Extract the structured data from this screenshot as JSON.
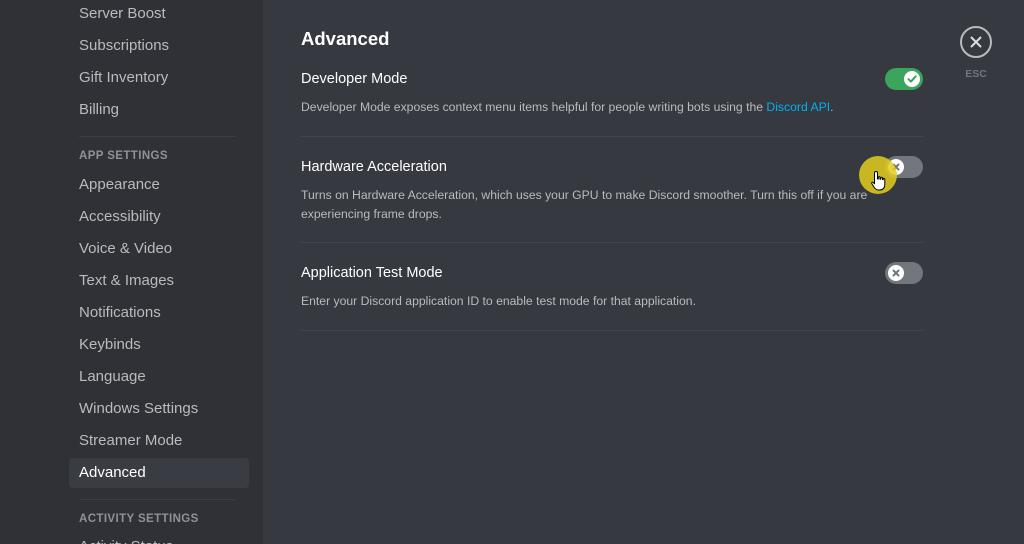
{
  "sidebar": {
    "top_items": [
      "Server Boost",
      "Subscriptions",
      "Gift Inventory",
      "Billing"
    ],
    "app_settings_header": "APP SETTINGS",
    "app_items": [
      "Appearance",
      "Accessibility",
      "Voice & Video",
      "Text & Images",
      "Notifications",
      "Keybinds",
      "Language",
      "Windows Settings",
      "Streamer Mode",
      "Advanced"
    ],
    "selected": "Advanced",
    "activity_settings_header": "ACTIVITY SETTINGS",
    "activity_items": [
      "Activity Status"
    ]
  },
  "main": {
    "title": "Advanced",
    "settings": [
      {
        "title": "Developer Mode",
        "description": "Developer Mode exposes context menu items helpful for people writing bots using the ",
        "link_text": "Discord API",
        "description_suffix": ".",
        "enabled": true
      },
      {
        "title": "Hardware Acceleration",
        "description": "Turns on Hardware Acceleration, which uses your GPU to make Discord smoother. Turn this off if you are experiencing frame drops.",
        "enabled": false
      },
      {
        "title": "Application Test Mode",
        "description": "Enter your Discord application ID to enable test mode for that application.",
        "enabled": false
      }
    ]
  },
  "close": {
    "label": "ESC"
  },
  "colors": {
    "toggle_on": "#3ba55c",
    "toggle_off": "#72767d",
    "link": "#00b0f4",
    "cursor_highlight": "#e2cd1e"
  }
}
